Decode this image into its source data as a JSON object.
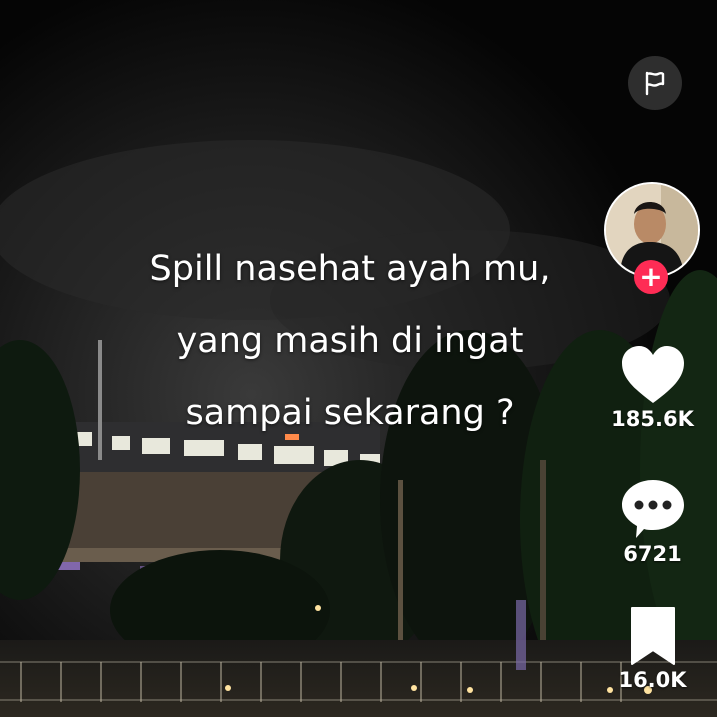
{
  "caption": {
    "lines": [
      "Spill nasehat ayah mu,",
      "yang masih di ingat",
      "sampai sekarang ?"
    ]
  },
  "actions": {
    "like_count": "185.6K",
    "comment_count": "6721",
    "save_count": "16.0K",
    "follow_symbol": "+"
  },
  "icons": {
    "report": "flag-icon",
    "like": "heart-icon",
    "comment": "speech-bubble-icon",
    "save": "bookmark-icon"
  },
  "colors": {
    "follow_accent": "#fe2c55",
    "text": "#ffffff",
    "icon": "#ffffff"
  }
}
